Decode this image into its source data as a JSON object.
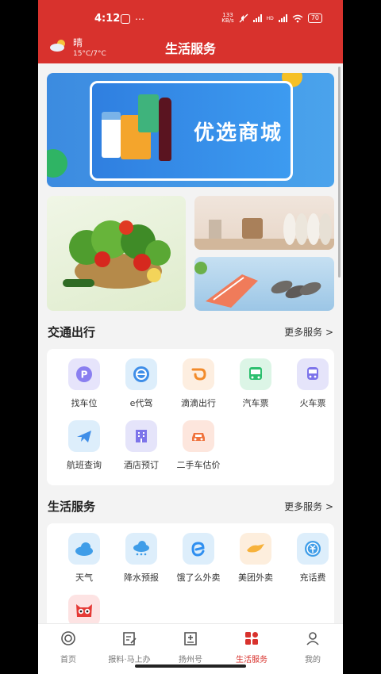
{
  "status_bar": {
    "time": "4:12",
    "dots": "⋯",
    "net_speed_value": "133",
    "net_speed_unit": "KB/s",
    "net_type": "HD",
    "battery": "70"
  },
  "header": {
    "weather_condition": "晴",
    "weather_temp": "15°C/7°C",
    "title": "生活服务"
  },
  "banner": {
    "title": "优选商城"
  },
  "sections": [
    {
      "title": "交通出行",
      "more": "更多服务 >",
      "items": [
        {
          "label": "找车位",
          "icon": "parking-icon"
        },
        {
          "label": "e代驾",
          "icon": "steering-wheel-icon"
        },
        {
          "label": "滴滴出行",
          "icon": "didi-icon"
        },
        {
          "label": "汽车票",
          "icon": "bus-icon"
        },
        {
          "label": "火车票",
          "icon": "train-icon"
        },
        {
          "label": "航班查询",
          "icon": "airplane-icon"
        },
        {
          "label": "酒店预订",
          "icon": "hotel-icon"
        },
        {
          "label": "二手车估价",
          "icon": "car-icon"
        }
      ]
    },
    {
      "title": "生活服务",
      "more": "更多服务 >",
      "items": [
        {
          "label": "天气",
          "icon": "cloud-icon"
        },
        {
          "label": "降水预报",
          "icon": "rain-icon"
        },
        {
          "label": "饿了么外卖",
          "icon": "eleme-icon"
        },
        {
          "label": "美团外卖",
          "icon": "meituan-icon"
        },
        {
          "label": "充话费",
          "icon": "recharge-icon"
        },
        {
          "label": "",
          "icon": "owl-icon"
        }
      ]
    }
  ],
  "tabs": [
    {
      "label": "首页",
      "icon": "home-icon"
    },
    {
      "label": "报料·马上办",
      "icon": "edit-icon"
    },
    {
      "label": "扬州号",
      "icon": "account-icon"
    },
    {
      "label": "生活服务",
      "icon": "grid-icon",
      "active": true
    },
    {
      "label": "我的",
      "icon": "person-icon"
    }
  ],
  "colors": {
    "brand": "#d8322d",
    "background": "#f3f3f3"
  }
}
